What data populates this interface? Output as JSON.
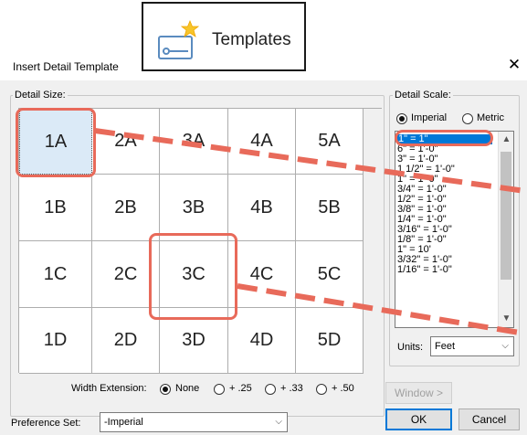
{
  "callout": {
    "label": "Templates",
    "icon": "templates-icon"
  },
  "dialog": {
    "title": "Insert Detail Template",
    "close_icon": "close-icon"
  },
  "detail_size": {
    "label": "Detail Size:",
    "rows": [
      [
        "1A",
        "2A",
        "3A",
        "4A",
        "5A"
      ],
      [
        "1B",
        "2B",
        "3B",
        "4B",
        "5B"
      ],
      [
        "1C",
        "2C",
        "3C",
        "4C",
        "5C"
      ],
      [
        "1D",
        "2D",
        "3D",
        "4D",
        "5D"
      ]
    ],
    "selected": "1A"
  },
  "width_extension": {
    "label": "Width Extension:",
    "options": [
      "None",
      "+ .25",
      "+ .33",
      "+ .50"
    ],
    "selected": "None"
  },
  "detail_scale": {
    "label": "Detail Scale:",
    "imperial_label": "Imperial",
    "metric_label": "Metric",
    "selected_system": "Imperial",
    "items": [
      "1\" = 1\"",
      "6\" = 1'-0\"",
      "3\" = 1'-0\"",
      "1 1/2\" = 1'-0\"",
      "1\" = 1'-0\"",
      "3/4\" = 1'-0\"",
      "1/2\" = 1'-0\"",
      "3/8\" = 1'-0\"",
      "1/4\" = 1'-0\"",
      "3/16\" = 1'-0\"",
      "1/8\" = 1'-0\"",
      "1\" = 10'",
      "3/32\" = 1'-0\"",
      "1/16\" = 1'-0\""
    ],
    "selected_item": "1\" = 1\""
  },
  "units": {
    "label": "Units:",
    "value": "Feet"
  },
  "preference_set": {
    "label": "Preference Set:",
    "value": "-Imperial"
  },
  "buttons": {
    "window": "Window >",
    "ok": "OK",
    "cancel": "Cancel"
  },
  "colors": {
    "highlight": "#e86a5a",
    "selection": "#0078d7",
    "cell_selected": "#dbeaf7"
  }
}
